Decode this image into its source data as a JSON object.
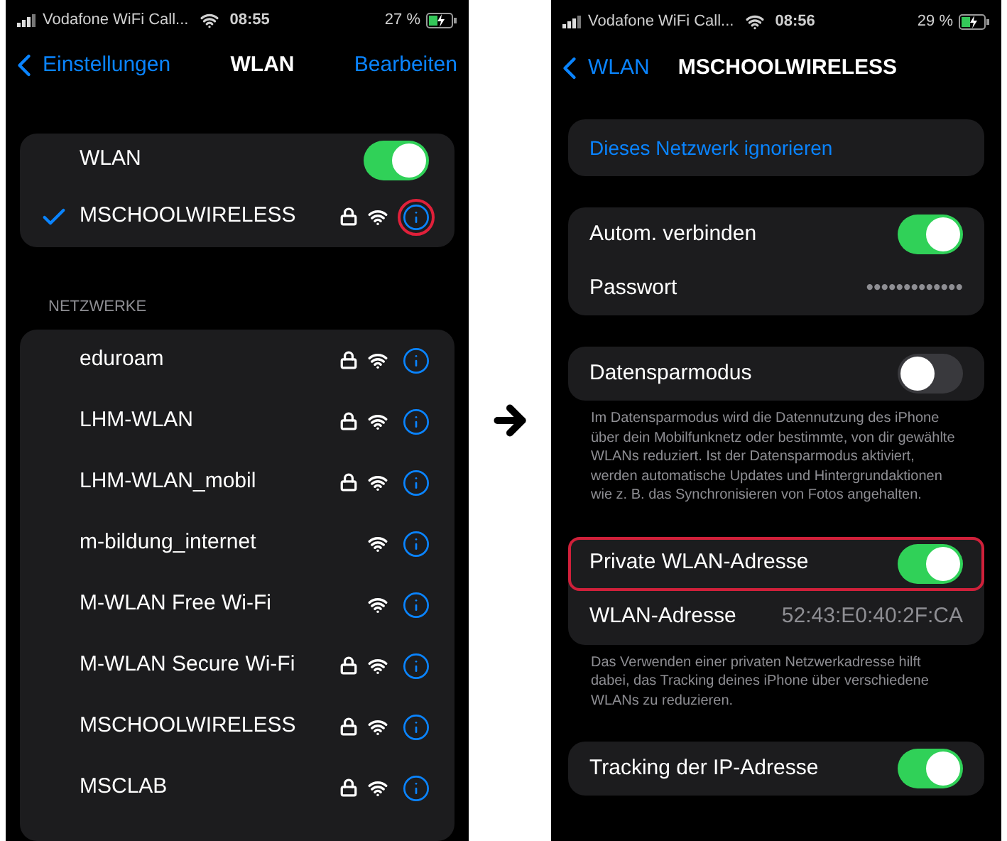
{
  "left_screen": {
    "status_bar": {
      "carrier": "Vodafone WiFi Call...",
      "time": "08:55",
      "battery": "27 %",
      "charging": true
    },
    "nav": {
      "back": "Einstellungen",
      "title": "WLAN",
      "action": "Bearbeiten"
    },
    "wlan": {
      "label": "WLAN",
      "on": true
    },
    "connected": {
      "name": "MSCHOOLWIRELESS",
      "checked": true,
      "locked": true,
      "highlighted": true
    },
    "networks_header": "NETZWERKE",
    "networks": [
      {
        "name": "eduroam",
        "locked": true,
        "highlighted": false
      },
      {
        "name": "LHM-WLAN",
        "locked": true,
        "highlighted": false
      },
      {
        "name": "LHM-WLAN_mobil",
        "locked": true,
        "highlighted": false
      },
      {
        "name": "m-bildung_internet",
        "locked": false,
        "highlighted": false
      },
      {
        "name": "M-WLAN Free Wi-Fi",
        "locked": false,
        "highlighted": false
      },
      {
        "name": "M-WLAN Secure Wi-Fi",
        "locked": true,
        "highlighted": false
      },
      {
        "name": "MSCHOOLWIRELESS",
        "locked": true,
        "highlighted": false
      },
      {
        "name": "MSCLAB",
        "locked": true,
        "highlighted": false
      }
    ]
  },
  "right_screen": {
    "status_bar": {
      "carrier": "Vodafone WiFi Call...",
      "time": "08:56",
      "battery": "29 %",
      "charging": true
    },
    "nav": {
      "back": "WLAN",
      "title": "MSCHOOLWIRELESS"
    },
    "forget_button": "Dieses Netzwerk ignorieren",
    "sections": [
      {
        "rows": [
          {
            "kind": "toggle",
            "label": "Autom. verbinden",
            "on": true,
            "highlighted": false
          },
          {
            "kind": "value",
            "label": "Passwort",
            "value": "•••••••••••••",
            "highlighted": false
          }
        ]
      },
      {
        "rows": [
          {
            "kind": "toggle",
            "label": "Datensparmodus",
            "on": false,
            "highlighted": false
          }
        ],
        "footnote": "Im Datensparmodus wird die Datennutzung des iPhone über dein Mobilfunknetz oder bestimmte, von dir gewählte WLANs reduziert. Ist der Datensparmodus aktiviert, werden automatische Updates und Hintergrundaktionen wie z. B. das Synchronisieren von Fotos angehalten."
      },
      {
        "rows": [
          {
            "kind": "toggle",
            "label": "Private WLAN-Adresse",
            "on": true,
            "highlighted": true
          },
          {
            "kind": "value",
            "label": "WLAN-Adresse",
            "value": "52:43:E0:40:2F:CA",
            "highlighted": false
          }
        ],
        "footnote": "Das Verwenden einer privaten Netzwerkadresse hilft dabei, das Tracking deines iPhone über verschiedene WLANs zu reduzieren."
      },
      {
        "rows": [
          {
            "kind": "toggle",
            "label": "Tracking der IP-Adresse",
            "on": true,
            "highlighted": false
          }
        ]
      }
    ]
  }
}
